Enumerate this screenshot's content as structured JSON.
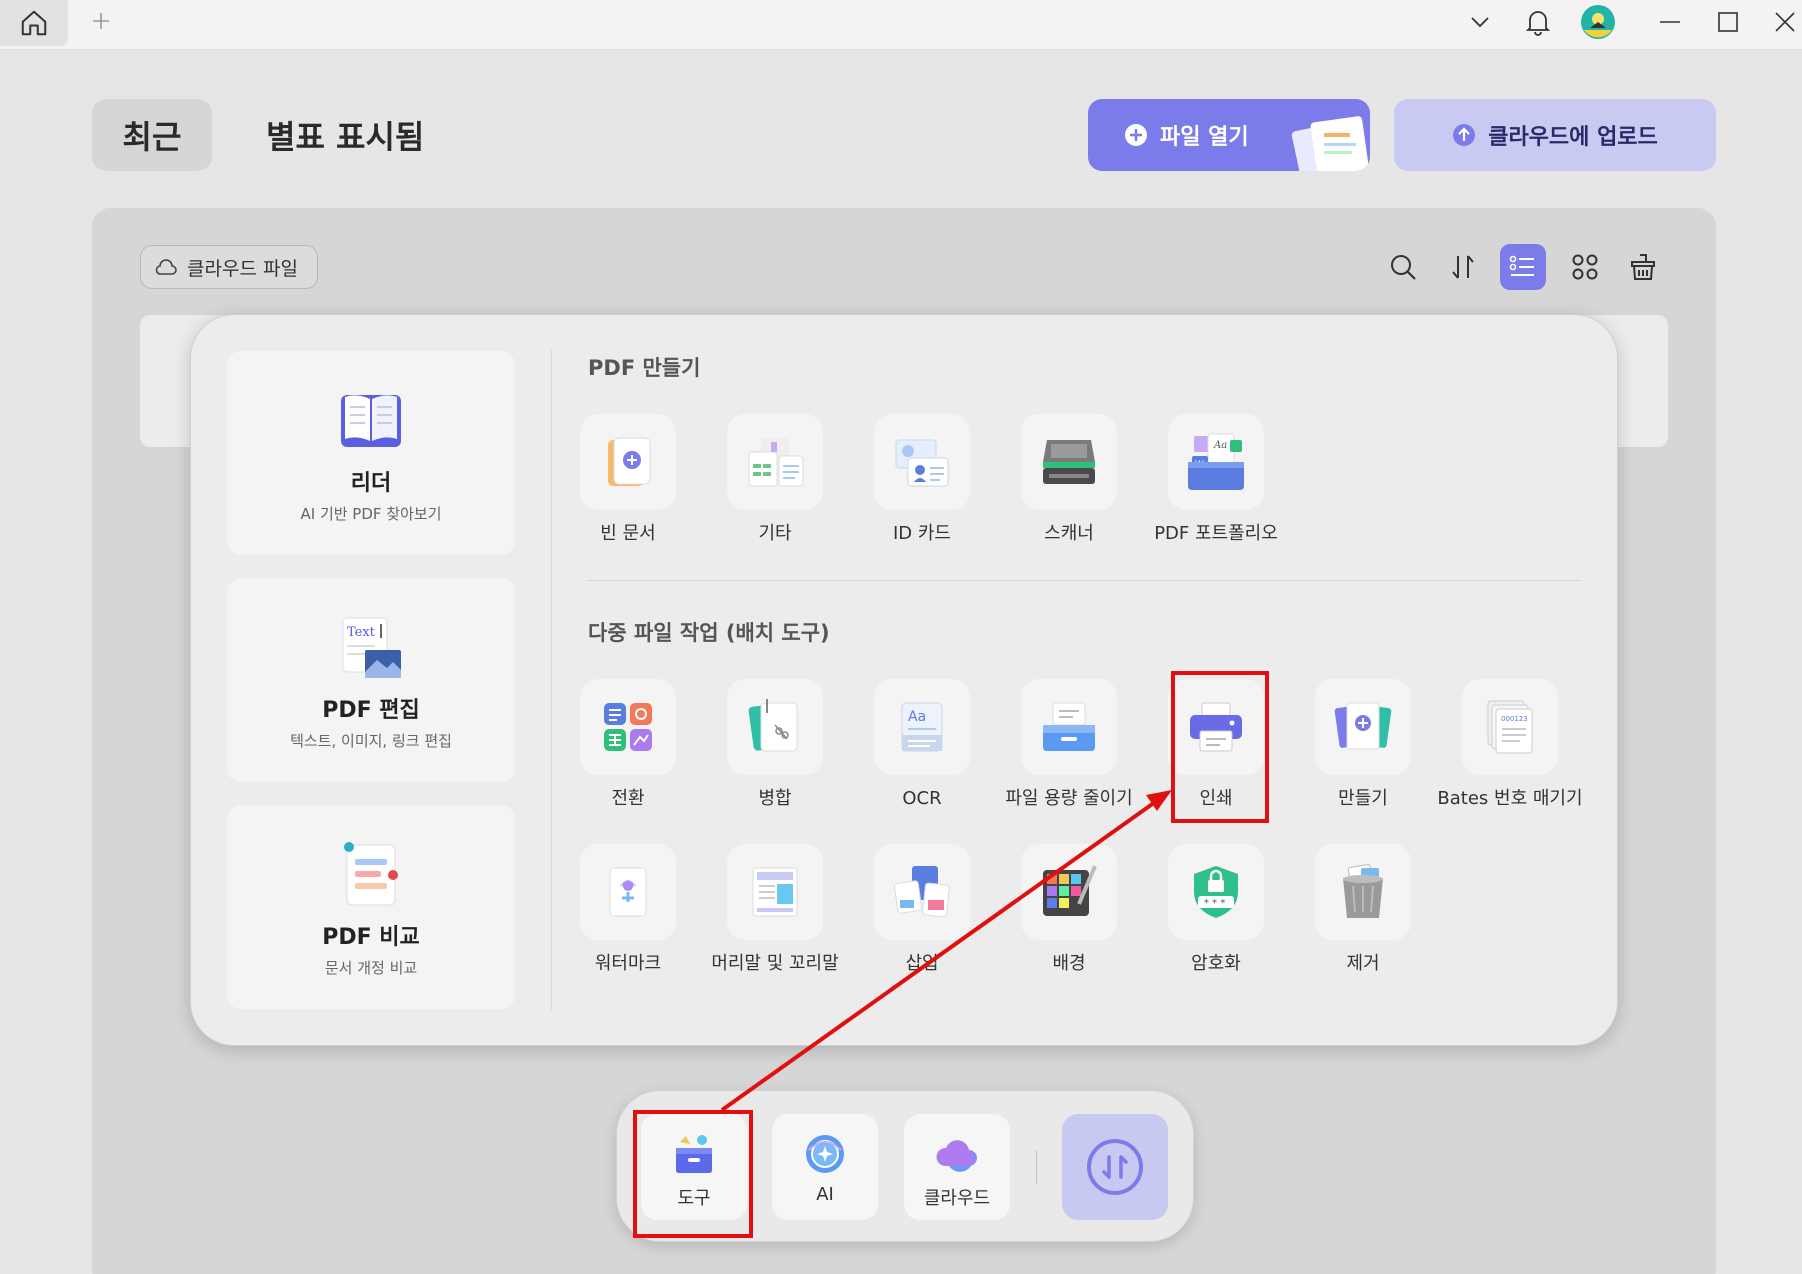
{
  "header": {
    "tab_recent": "최근",
    "tab_starred": "별표 표시됨",
    "open_file": "파일 열기",
    "upload_cloud": "클라우드에 업로드"
  },
  "toolbar": {
    "cloud_files": "클라우드 파일"
  },
  "left_cards": [
    {
      "title": "리더",
      "subtitle": "AI 기반 PDF 찾아보기"
    },
    {
      "title": "PDF 편집",
      "subtitle": "텍스트, 이미지, 링크 편집"
    },
    {
      "title": "PDF 비교",
      "subtitle": "문서 개정 비교"
    }
  ],
  "create_section": {
    "title": "PDF 만들기",
    "items": [
      "빈 문서",
      "기타",
      "ID 카드",
      "스캐너",
      "PDF 포트폴리오"
    ]
  },
  "batch_section": {
    "title": "다중 파일 작업 (배치 도구)",
    "row1": [
      "전환",
      "병합",
      "OCR",
      "파일 용량 줄이기",
      "인쇄",
      "만들기",
      "Bates 번호 매기기"
    ],
    "row2": [
      "워터마크",
      "머리말 및 꼬리말",
      "삽입",
      "배경",
      "암호화",
      "제거"
    ]
  },
  "dock": {
    "tools": "도구",
    "ai": "AI",
    "cloud": "클라우드"
  },
  "colors": {
    "accent": "#7b7bea",
    "annotation": "#e01010"
  }
}
